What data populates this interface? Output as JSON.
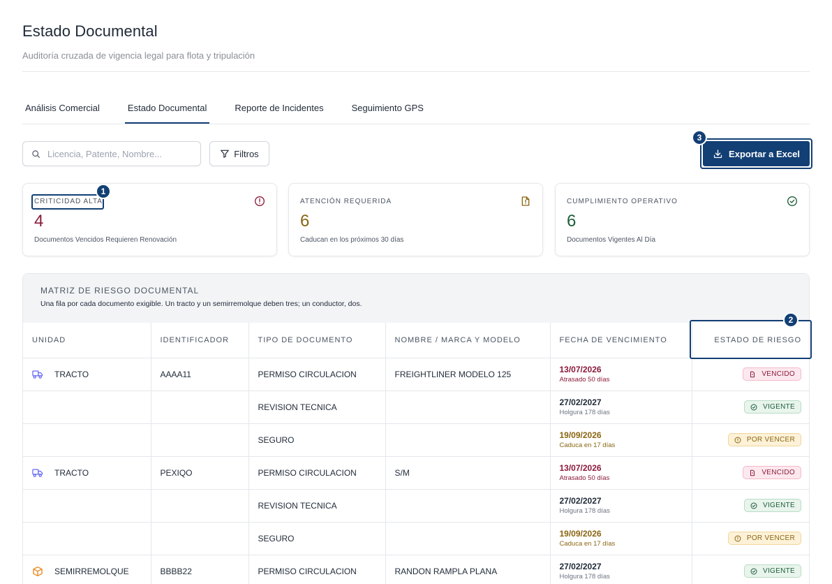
{
  "header": {
    "title": "Estado Documental",
    "subtitle": "Auditoría cruzada de vigencia legal para flota y tripulación"
  },
  "tabs": [
    {
      "label": "Análisis Comercial",
      "active": false
    },
    {
      "label": "Estado Documental",
      "active": true
    },
    {
      "label": "Reporte de Incidentes",
      "active": false
    },
    {
      "label": "Seguimiento GPS",
      "active": false
    }
  ],
  "toolbar": {
    "search_placeholder": "Licencia, Patente, Nombre...",
    "filter_label": "Filtros",
    "export_label": "Exportar a Excel"
  },
  "markers": [
    "1",
    "2",
    "3"
  ],
  "cards": [
    {
      "label": "CRITICIDAD ALTA",
      "value": "4",
      "description": "Documentos Vencidos Requieren Renovación",
      "icon": "alert-circle-icon",
      "color": "#8b1a3a"
    },
    {
      "label": "ATENCIÓN REQUERIDA",
      "value": "6",
      "description": "Caducan en los próximos 30 días",
      "icon": "document-alert-icon",
      "color": "#8a6510"
    },
    {
      "label": "CUMPLIMIENTO OPERATIVO",
      "value": "6",
      "description": "Documentos Vigentes Al Día",
      "icon": "check-circle-icon",
      "color": "#1e5e3a"
    }
  ],
  "matrix": {
    "title": "MATRIZ DE RIESGO DOCUMENTAL",
    "description": "Una fila por cada documento exigible. Un tracto y un semirremolque deben tres; un conductor, dos.",
    "columns": [
      "UNIDAD",
      "IDENTIFICADOR",
      "TIPO DE DOCUMENTO",
      "NOMBRE / MARCA Y MODELO",
      "FECHA DE VENCIMIENTO",
      "ESTADO DE RIESGO"
    ],
    "rows": [
      {
        "unit": "TRACTO",
        "unit_icon": "truck-icon",
        "identifier": "AAAA11",
        "doc_type": "PERMISO CIRCULACION",
        "name": "FREIGHTLINER MODELO 125",
        "date": "13/07/2026",
        "date_note": "Atrasado 50 días",
        "status": "VENCIDO",
        "level": "red"
      },
      {
        "unit": "",
        "unit_icon": "",
        "identifier": "",
        "doc_type": "REVISION TECNICA",
        "name": "",
        "date": "27/02/2027",
        "date_note": "Holgura 178 días",
        "status": "VIGENTE",
        "level": "green"
      },
      {
        "unit": "",
        "unit_icon": "",
        "identifier": "",
        "doc_type": "SEGURO",
        "name": "",
        "date": "19/09/2026",
        "date_note": "Caduca en 17 días",
        "status": "POR VENCER",
        "level": "amber"
      },
      {
        "unit": "TRACTO",
        "unit_icon": "truck-icon",
        "identifier": "PEXIQO",
        "doc_type": "PERMISO CIRCULACION",
        "name": "S/M",
        "date": "13/07/2026",
        "date_note": "Atrasado 50 días",
        "status": "VENCIDO",
        "level": "red"
      },
      {
        "unit": "",
        "unit_icon": "",
        "identifier": "",
        "doc_type": "REVISION TECNICA",
        "name": "",
        "date": "27/02/2027",
        "date_note": "Holgura 178 días",
        "status": "VIGENTE",
        "level": "green"
      },
      {
        "unit": "",
        "unit_icon": "",
        "identifier": "",
        "doc_type": "SEGURO",
        "name": "",
        "date": "19/09/2026",
        "date_note": "Caduca en 17 días",
        "status": "POR VENCER",
        "level": "amber"
      },
      {
        "unit": "SEMIRREMOLQUE",
        "unit_icon": "package-icon",
        "identifier": "BBBB22",
        "doc_type": "PERMISO CIRCULACION",
        "name": "RANDON RAMPLA PLANA",
        "date": "27/02/2027",
        "date_note": "Holgura 178 días",
        "status": "VIGENTE",
        "level": "green"
      }
    ]
  },
  "colors": {
    "primary": "#123f74",
    "danger": "#8b1a3a",
    "warning": "#8a6510",
    "success": "#1e5e3a",
    "truck_icon": "#6366f1",
    "package_icon": "#e8871e"
  }
}
